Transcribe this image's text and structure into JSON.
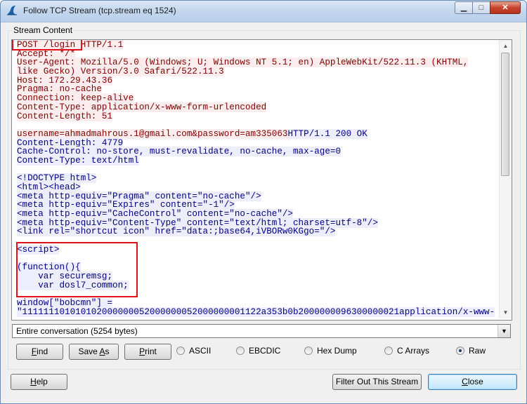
{
  "window": {
    "title": "Follow TCP Stream (tcp.stream eq 1524)",
    "min_symbol": "▁",
    "max_symbol": "□",
    "close_symbol": "✕"
  },
  "group_label": "Stream Content",
  "stream_lines": [
    {
      "text": "POST /login HTTP/1.1",
      "dir": "client"
    },
    {
      "text": "Accept: */*",
      "dir": "client"
    },
    {
      "text": "User-Agent: Mozilla/5.0 (Windows; U; Windows NT 5.1; en) AppleWebKit/522.11.3 (KHTML,",
      "dir": "client"
    },
    {
      "text": "like Gecko) Version/3.0 Safari/522.11.3",
      "dir": "client"
    },
    {
      "text": "Host: 172.29.43.36",
      "dir": "client"
    },
    {
      "text": "Pragma: no-cache",
      "dir": "client"
    },
    {
      "text": "Connection: keep-alive",
      "dir": "client"
    },
    {
      "text": "Content-Type: application/x-www-form-urlencoded",
      "dir": "client"
    },
    {
      "text": "Content-Length: 51",
      "dir": "client"
    },
    {
      "text": "",
      "dir": "blank"
    },
    {
      "parts": [
        {
          "text": "username=ahmadmahrous.1@gmail.com&password=am335063",
          "dir": "client"
        },
        {
          "text": "HTTP/1.1 200 OK",
          "dir": "server"
        }
      ]
    },
    {
      "text": "Content-Length: 4779",
      "dir": "server"
    },
    {
      "text": "Cache-Control: no-store, must-revalidate, no-cache, max-age=0",
      "dir": "server"
    },
    {
      "text": "Content-Type: text/html",
      "dir": "server"
    },
    {
      "text": "",
      "dir": "blank"
    },
    {
      "text": "<!DOCTYPE html>",
      "dir": "server"
    },
    {
      "text": "<html><head>",
      "dir": "server"
    },
    {
      "text": "<meta http-equiv=\"Pragma\" content=\"no-cache\"/>",
      "dir": "server"
    },
    {
      "text": "<meta http-equiv=\"Expires\" content=\"-1\"/>",
      "dir": "server"
    },
    {
      "text": "<meta http-equiv=\"CacheControl\" content=\"no-cache\"/>",
      "dir": "server"
    },
    {
      "text": "<meta http-equiv=\"Content-Type\" content=\"text/html; charset=utf-8\"/>",
      "dir": "server"
    },
    {
      "text": "<link rel=\"shortcut icon\" href=\"data:;base64,iVBORw0KGgo=\"/>",
      "dir": "server"
    },
    {
      "text": "",
      "dir": "blank"
    },
    {
      "text": "<script>",
      "dir": "server"
    },
    {
      "text": "",
      "dir": "blank"
    },
    {
      "text": "(function(){",
      "dir": "server"
    },
    {
      "text": "    var securemsg;",
      "dir": "server"
    },
    {
      "text": "    var dosl7_common;",
      "dir": "server"
    },
    {
      "text": "",
      "dir": "blank"
    },
    {
      "text": "window[\"bobcmn\"] =",
      "dir": "server"
    },
    {
      "text": "\"111111101010102000000052000000052000000001122a353b0b2000000096300000021application/x-www-",
      "dir": "server"
    }
  ],
  "scrollbar": {
    "up": "▲",
    "down": "▼"
  },
  "conversation_select": {
    "value": "Entire conversation (5254 bytes)",
    "arrow": "▼"
  },
  "buttons": {
    "find": {
      "pre": "",
      "key": "F",
      "post": "ind"
    },
    "save_as": {
      "pre": "Save ",
      "key": "A",
      "post": "s"
    },
    "print": {
      "pre": "",
      "key": "P",
      "post": "rint"
    },
    "help": {
      "pre": "",
      "key": "H",
      "post": "elp"
    },
    "filter_out": "Filter Out This Stream",
    "close": {
      "pre": "",
      "key": "C",
      "post": "lose"
    }
  },
  "radios": [
    {
      "label": "ASCII",
      "checked": false
    },
    {
      "label": "EBCDIC",
      "checked": false
    },
    {
      "label": "Hex Dump",
      "checked": false
    },
    {
      "label": "C Arrays",
      "checked": false
    },
    {
      "label": "Raw",
      "checked": true
    }
  ],
  "colors": {
    "client_fg": "#800000",
    "client_bg": "#fbeded",
    "server_fg": "#000080",
    "server_bg": "#ededfb",
    "highlight_box": "#e0101a"
  }
}
